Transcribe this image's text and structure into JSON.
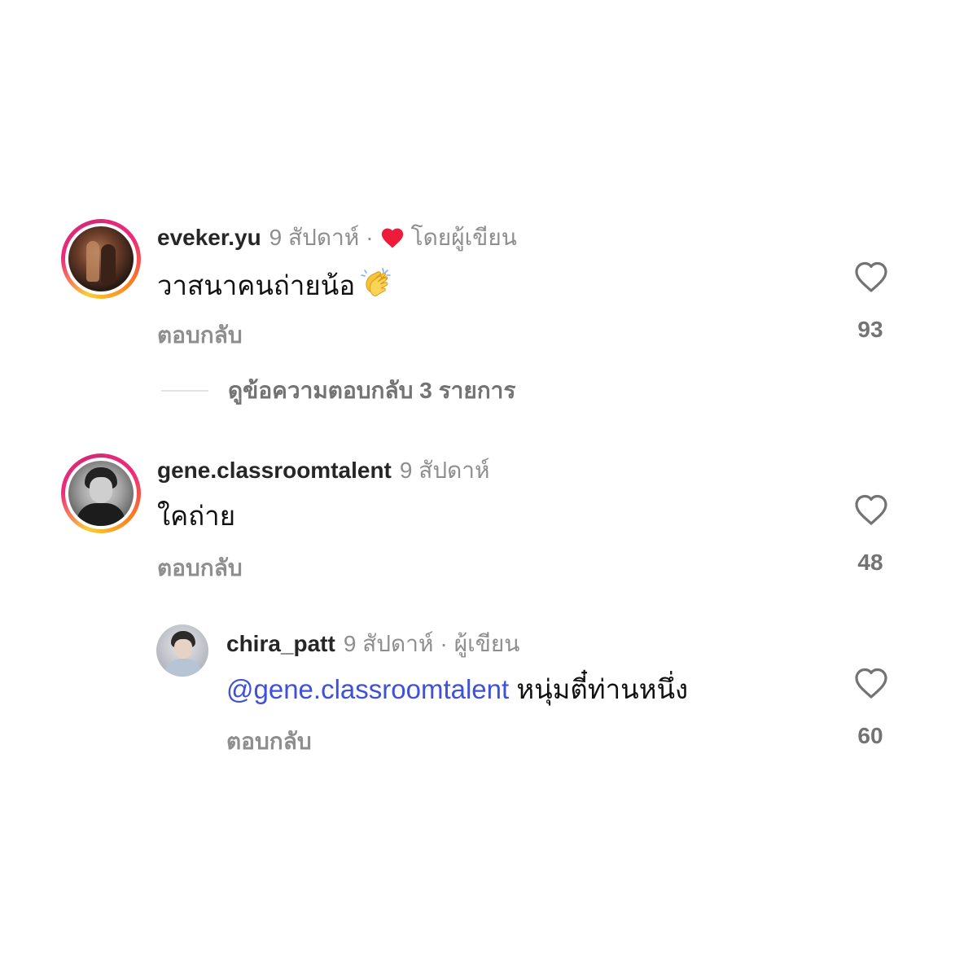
{
  "comments": [
    {
      "username": "eveker.yu",
      "time": "9 สัปดาห์",
      "separator": "·",
      "author_liked_label": "โดยผู้เขียน",
      "text": "วาสนาคนถ่ายน้อ",
      "emoji_name": "clapping-hands-emoji",
      "reply_label": "ตอบกลับ",
      "likes": "93",
      "view_replies_label": "ดูข้อความตอบกลับ 3 รายการ"
    },
    {
      "username": "gene.classroomtalent",
      "time": "9 สัปดาห์",
      "text": "ใคถ่าย",
      "reply_label": "ตอบกลับ",
      "likes": "48"
    }
  ],
  "reply": {
    "username": "chira_patt",
    "time": "9 สัปดาห์",
    "separator": "·",
    "author_label": "ผู้เขียน",
    "mention": "@gene.classroomtalent",
    "text": "หนุ่มตี๋ท่านหนึ่ง",
    "reply_label": "ตอบกลับ",
    "likes": "60"
  },
  "colors": {
    "mention": "#3f51d8",
    "muted": "#8e8e8e",
    "heart_red": "#ee1c3a"
  },
  "icons": {
    "like": "heart-outline-icon",
    "author_like": "heart-filled-icon"
  }
}
